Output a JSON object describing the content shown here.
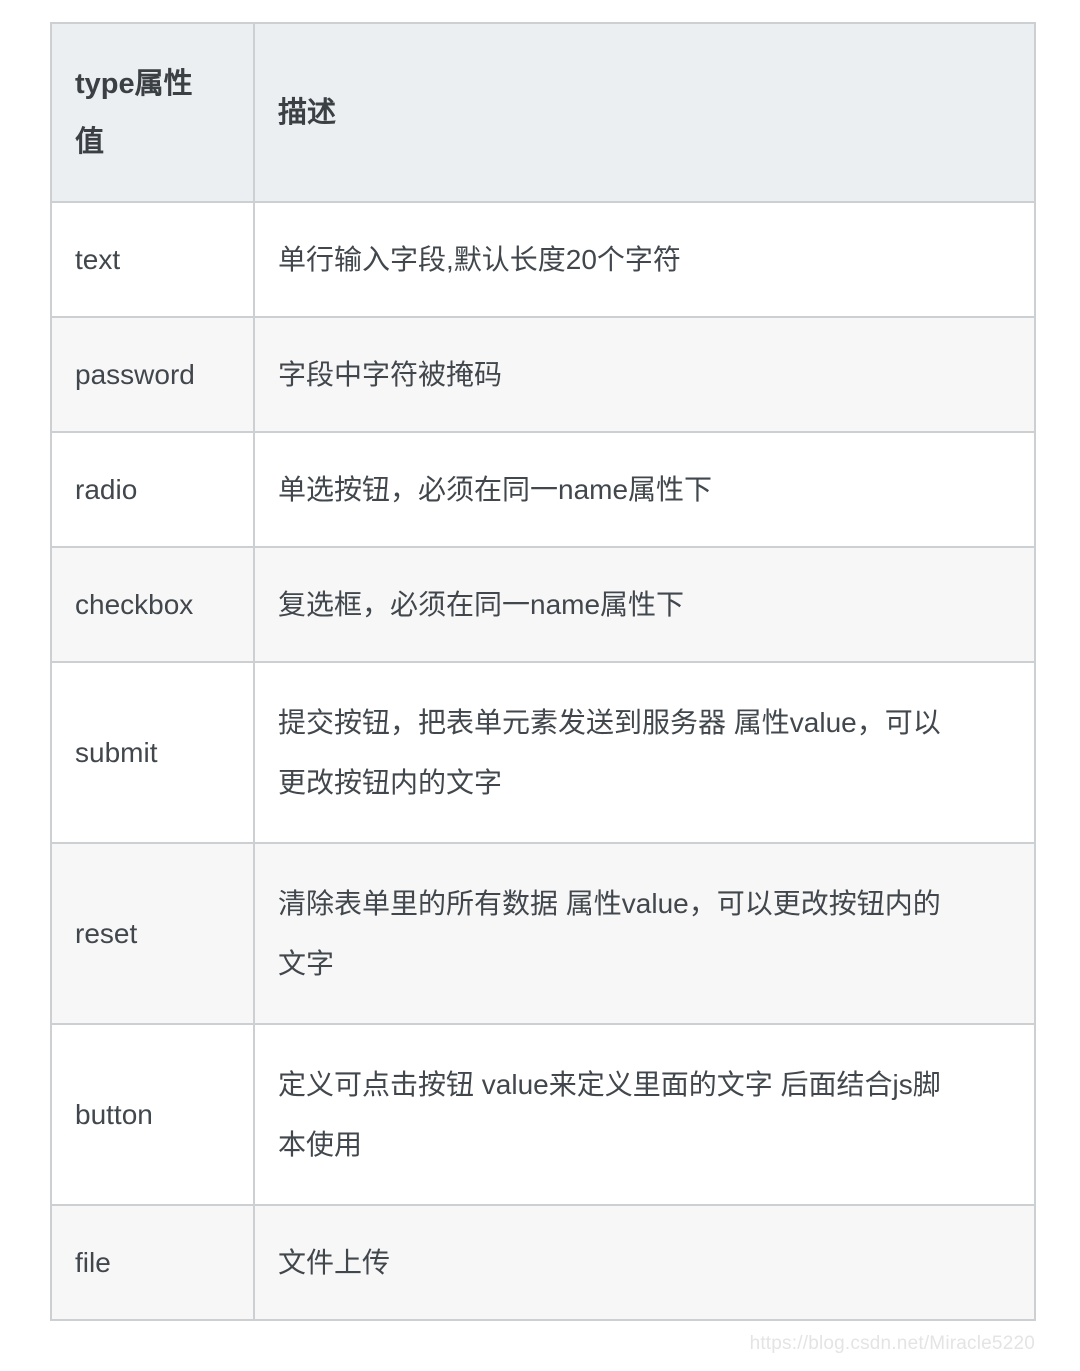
{
  "table": {
    "columns": [
      {
        "key": "type",
        "label": "type属性值"
      },
      {
        "key": "desc",
        "label": "描述"
      }
    ],
    "rows": [
      {
        "type": "text",
        "desc": "单行输入字段,默认长度20个字符"
      },
      {
        "type": "password",
        "desc": "字段中字符被掩码"
      },
      {
        "type": "radio",
        "desc": "单选按钮，必须在同一name属性下"
      },
      {
        "type": "checkbox",
        "desc": "复选框，必须在同一name属性下"
      },
      {
        "type": "submit",
        "desc": "提交按钮，把表单元素发送到服务器 属性value，可以更改按钮内的文字"
      },
      {
        "type": "reset",
        "desc": "清除表单里的所有数据 属性value，可以更改按钮内的文字"
      },
      {
        "type": "button",
        "desc": "定义可点击按钮 value来定义里面的文字 后面结合js脚本使用"
      },
      {
        "type": "file",
        "desc": "文件上传"
      }
    ]
  },
  "watermark": {
    "text": "https://blog.csdn.net/Miracle5220"
  },
  "colors": {
    "header_bg": "#eceff1",
    "row_bg": "#ffffff",
    "row_alt_bg": "#f7f7f7",
    "border": "#ccd0d2",
    "text": "#44494e",
    "header_text": "#3b4045",
    "watermark_text": "#e4e4e4"
  }
}
